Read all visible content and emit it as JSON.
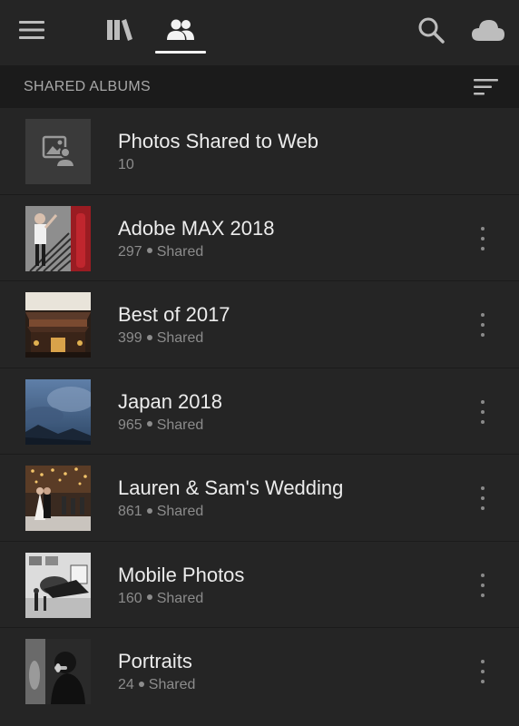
{
  "nav": {
    "icons": [
      "menu-icon",
      "library-icon",
      "shared-people-icon",
      "search-icon",
      "cloud-icon"
    ],
    "active_tab": "shared-people-icon"
  },
  "section": {
    "title": "SHARED ALBUMS",
    "sort_icon": "sort-icon"
  },
  "albums": [
    {
      "title": "Photos Shared to Web",
      "count": "10",
      "status": "",
      "thumbnail": "placeholder-image-icon"
    },
    {
      "title": "Adobe MAX 2018",
      "count": "297",
      "status": "Shared",
      "thumbnail": "photo"
    },
    {
      "title": "Best of 2017",
      "count": "399",
      "status": "Shared",
      "thumbnail": "photo"
    },
    {
      "title": "Japan 2018",
      "count": "965",
      "status": "Shared",
      "thumbnail": "photo"
    },
    {
      "title": "Lauren & Sam's Wedding",
      "count": "861",
      "status": "Shared",
      "thumbnail": "photo"
    },
    {
      "title": "Mobile Photos",
      "count": "160",
      "status": "Shared",
      "thumbnail": "photo"
    },
    {
      "title": "Portraits",
      "count": "24",
      "status": "Shared",
      "thumbnail": "photo"
    }
  ],
  "colors": {
    "background": "#252525",
    "section_bar": "#1b1b1b",
    "text": "#ececec",
    "muted_text": "#8c8c8c"
  }
}
